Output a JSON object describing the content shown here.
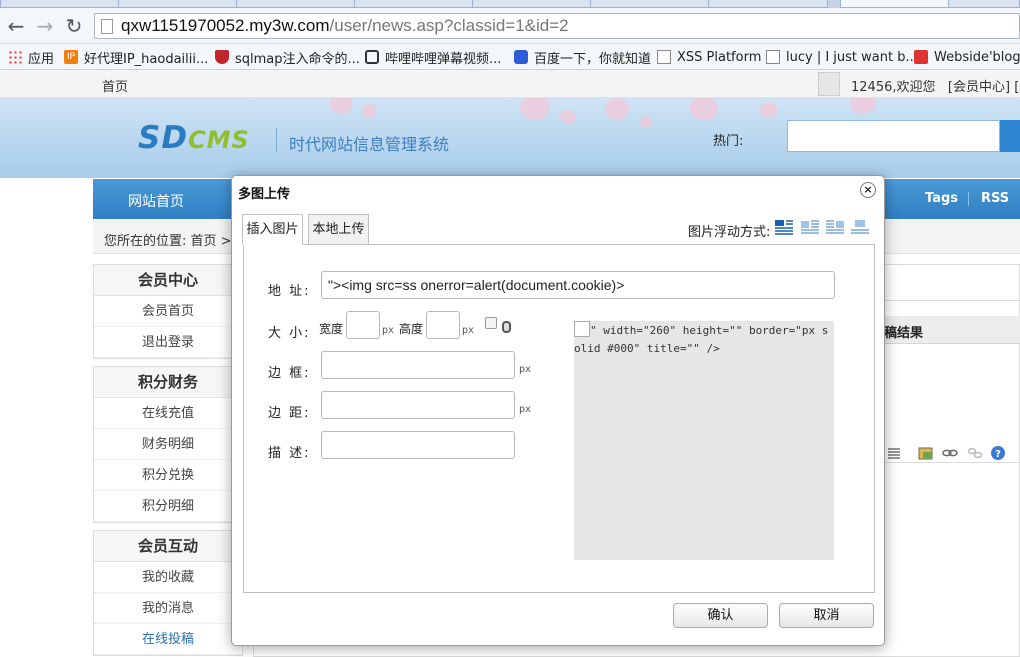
{
  "browser": {
    "url_prefix": "qxw1151970052.my3w.com",
    "url_path": "/user/news.asp?classid=1&id=2",
    "bookmarks": [
      {
        "label": "应用",
        "icon": "apps-grid-icon"
      },
      {
        "label": "好代理IP_haodailii...",
        "icon": "ip-logo-icon"
      },
      {
        "label": "sqlmap注入命令的...",
        "icon": "shield-icon"
      },
      {
        "label": "哔哩哔哩弹幕视频...",
        "icon": "tv-icon"
      },
      {
        "label": "百度一下，你就知道",
        "icon": "baidu-paw-icon"
      },
      {
        "label": "XSS Platform",
        "icon": "page-icon"
      },
      {
        "label": "lucy | I just want b...",
        "icon": "page-icon"
      },
      {
        "label": "Webside'blog",
        "icon": "blog-icon"
      }
    ]
  },
  "site": {
    "topbar": {
      "home": "首页",
      "welcome": "12456,欢迎您",
      "member_center": "[会员中心]",
      "logout_fragment": "[退"
    },
    "logo": {
      "sd": "SD",
      "cms": "CMS"
    },
    "tagline": "时代网站信息管理系统",
    "hot_label": "热门:",
    "nav": {
      "home": "网站首页",
      "tags": "Tags",
      "rss": "RSS"
    },
    "breadcrumb": "您所在的位置: 首页 >",
    "sidebar": [
      {
        "title": "会员中心",
        "items": [
          "会员首页",
          "退出登录"
        ]
      },
      {
        "title": "积分财务",
        "items": [
          "在线充值",
          "财务明细",
          "积分兑换",
          "积分明细"
        ]
      },
      {
        "title": "会员互动",
        "items": [
          "我的收藏",
          "我的消息",
          "在线投稿"
        ]
      }
    ],
    "result_fragment": "稿结果"
  },
  "dialog": {
    "title": "多图上传",
    "close": "×",
    "tabs": [
      "插入图片",
      "本地上传"
    ],
    "float_label": "图片浮动方式:",
    "fields": {
      "address_label": "地 址:",
      "address_value": "\"><img src=ss onerror=alert(document.cookie)>",
      "size_label": "大 小:",
      "width_label": "宽度",
      "height_label": "高度",
      "unit": "px",
      "border_label": "边 框:",
      "margin_label": "边 距:",
      "desc_label": "描 述:"
    },
    "preview_text": "\" width=\"260\" height=\"\" border=\"px solid #000\" title=\"\" />",
    "ok": "确认",
    "cancel": "取消"
  }
}
